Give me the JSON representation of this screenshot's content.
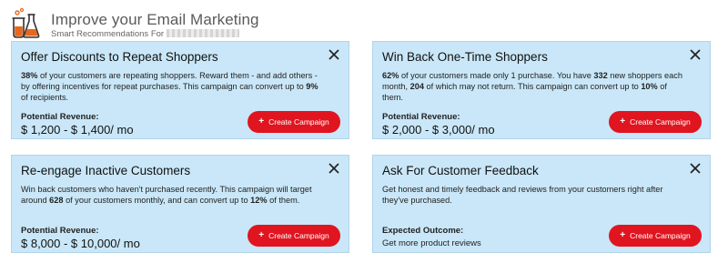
{
  "header": {
    "title": "Improve your Email Marketing",
    "subtitle": "Smart Recommendations For"
  },
  "cards": [
    {
      "title": "Offer Discounts to Repeat Shoppers",
      "desc": [
        {
          "t": "38%",
          "b": true
        },
        {
          "t": " of your customers are repeating shoppers. Reward them - and add others - by offering incentives for repeat purchases. This campaign can convert up to ",
          "b": false
        },
        {
          "t": "9%",
          "b": true
        },
        {
          "t": " of recipients.",
          "b": false
        }
      ],
      "metric_label": "Potential Revenue:",
      "metric_value": "$ 1,200 - $ 1,400/ mo",
      "cta_label": "Create Campaign"
    },
    {
      "title": "Win Back One-Time Shoppers",
      "desc": [
        {
          "t": "62%",
          "b": true
        },
        {
          "t": " of your customers made only 1 purchase. You have ",
          "b": false
        },
        {
          "t": "332",
          "b": true
        },
        {
          "t": " new shoppers each month, ",
          "b": false
        },
        {
          "t": "204",
          "b": true
        },
        {
          "t": " of which may not return. This campaign can convert up to ",
          "b": false
        },
        {
          "t": "10%",
          "b": true
        },
        {
          "t": " of them.",
          "b": false
        }
      ],
      "metric_label": "Potential Revenue:",
      "metric_value": "$ 2,000 - $ 3,000/ mo",
      "cta_label": "Create Campaign"
    },
    {
      "title": "Re-engage Inactive Customers",
      "desc": [
        {
          "t": "Win back customers who haven't purchased recently. This campaign will target around ",
          "b": false
        },
        {
          "t": "628",
          "b": true
        },
        {
          "t": " of your customers monthly, and can convert up to ",
          "b": false
        },
        {
          "t": "12%",
          "b": true
        },
        {
          "t": " of them.",
          "b": false
        }
      ],
      "metric_label": "Potential Revenue:",
      "metric_value": "$ 8,000 - $ 10,000/ mo",
      "cta_label": "Create Campaign"
    },
    {
      "title": "Ask For Customer Feedback",
      "desc": [
        {
          "t": "Get honest and timely feedback and reviews from your customers right after they've purchased.",
          "b": false
        }
      ],
      "metric_label": "Expected Outcome:",
      "metric_value": "Get more product reviews",
      "cta_label": "Create Campaign"
    }
  ],
  "icons": {
    "logo": "lab-flask-icon",
    "close": "close-icon",
    "cta": "plus-icon"
  },
  "colors": {
    "card_bg": "#c9e7f8",
    "cta_bg": "#e0151f",
    "logo_accent": "#e8671c"
  }
}
